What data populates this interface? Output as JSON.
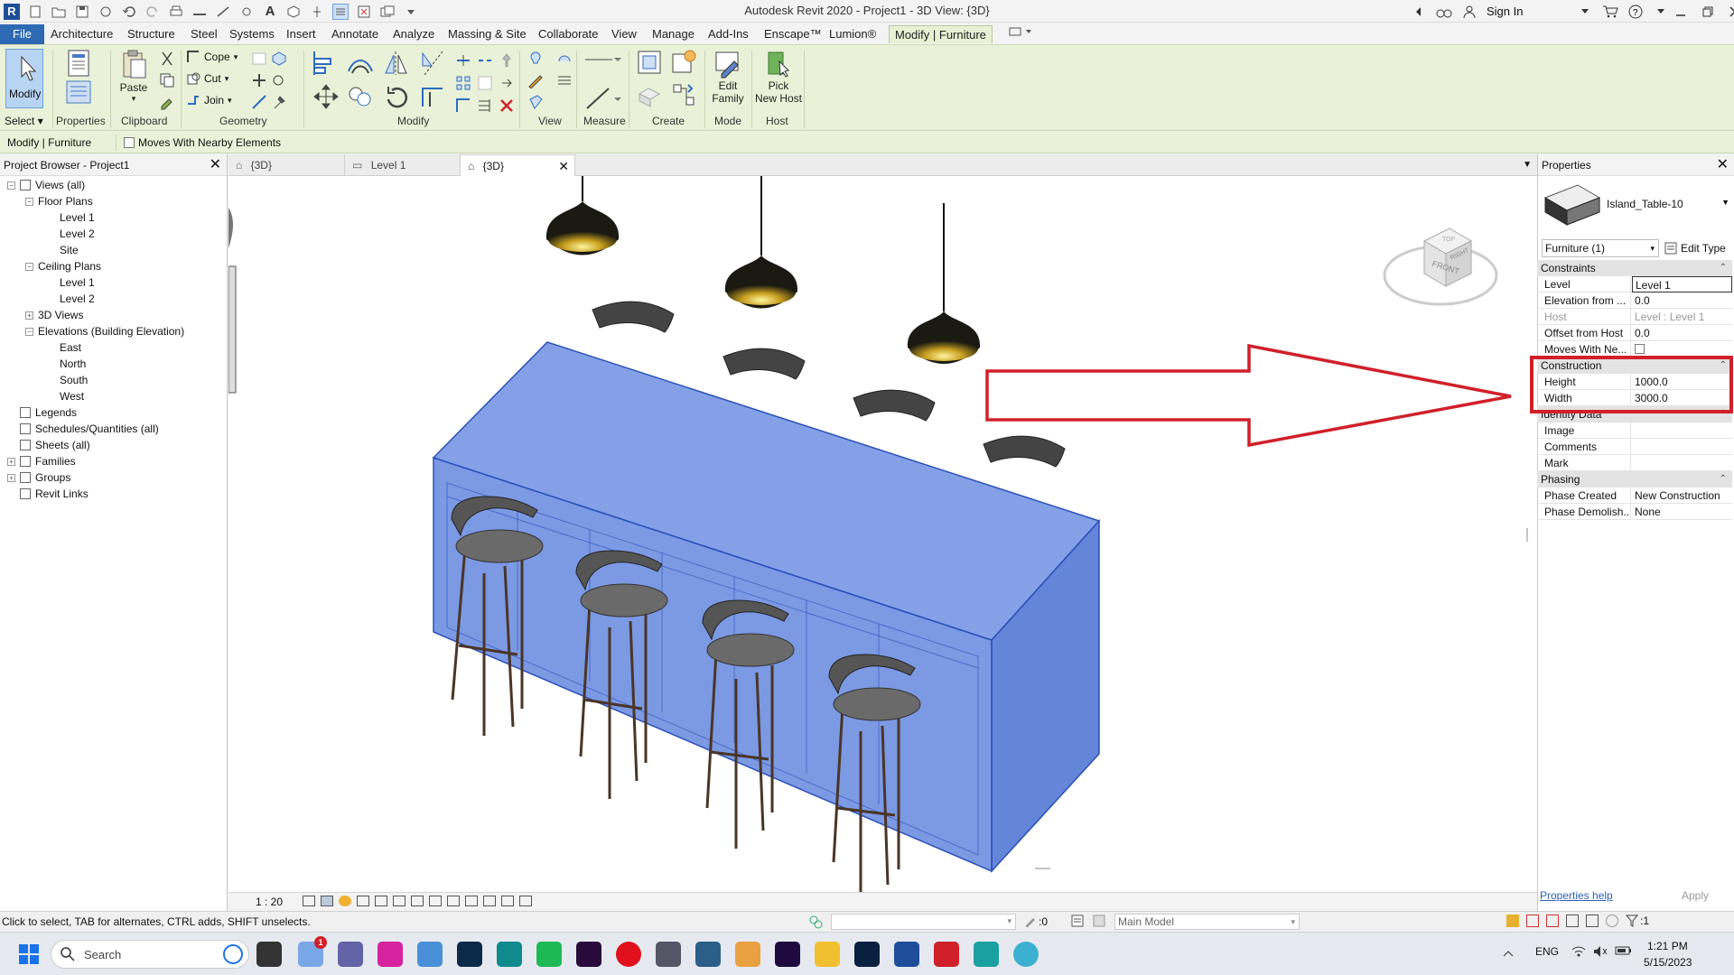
{
  "app": {
    "window_title": "Autodesk Revit 2020 - Project1 - 3D View: {3D}",
    "sign_in": "Sign In",
    "logo_letter": "R"
  },
  "menu": {
    "tabs": [
      "File",
      "Architecture",
      "Structure",
      "Steel",
      "Systems",
      "Insert",
      "Annotate",
      "Analyze",
      "Massing & Site",
      "Collaborate",
      "View",
      "Manage",
      "Add-Ins",
      "Enscape™",
      "Lumion®",
      "Modify | Furniture"
    ],
    "active_tab": "Modify | Furniture"
  },
  "ribbon": {
    "modify_label": "Modify",
    "select_label": "Select",
    "properties_label": "Properties",
    "paste_label": "Paste",
    "cope_label": "Cope",
    "cut_label": "Cut",
    "join_label": "Join",
    "edit_family_label_1": "Edit",
    "edit_family_label_2": "Family",
    "pick_host_label_1": "Pick",
    "pick_host_label_2": "New Host",
    "panels": {
      "clipboard": "Clipboard",
      "geometry": "Geometry",
      "modify": "Modify",
      "view": "View",
      "measure": "Measure",
      "create": "Create",
      "mode": "Mode",
      "host": "Host"
    }
  },
  "options_bar": {
    "context": "Modify | Furniture",
    "moves_with_nearby": "Moves With Nearby Elements"
  },
  "project_browser": {
    "title": "Project Browser - Project1",
    "items": [
      {
        "label": "Views (all)",
        "level": 0,
        "toggle": "−"
      },
      {
        "label": "Floor Plans",
        "level": 1,
        "toggle": "−"
      },
      {
        "label": "Level 1",
        "level": 2
      },
      {
        "label": "Level 2",
        "level": 2
      },
      {
        "label": "Site",
        "level": 2
      },
      {
        "label": "Ceiling Plans",
        "level": 1,
        "toggle": "−"
      },
      {
        "label": "Level 1",
        "level": 2
      },
      {
        "label": "Level 2",
        "level": 2
      },
      {
        "label": "3D Views",
        "level": 1,
        "toggle": "+"
      },
      {
        "label": "Elevations (Building Elevation)",
        "level": 1,
        "toggle": "−"
      },
      {
        "label": "East",
        "level": 2
      },
      {
        "label": "North",
        "level": 2
      },
      {
        "label": "South",
        "level": 2
      },
      {
        "label": "West",
        "level": 2
      },
      {
        "label": "Legends",
        "level": 0
      },
      {
        "label": "Schedules/Quantities (all)",
        "level": 0
      },
      {
        "label": "Sheets (all)",
        "level": 0
      },
      {
        "label": "Families",
        "level": 0,
        "toggle": "+"
      },
      {
        "label": "Groups",
        "level": 0,
        "toggle": "+"
      },
      {
        "label": "Revit Links",
        "level": 0
      }
    ]
  },
  "view_tabs": [
    {
      "label": "{3D}"
    },
    {
      "label": "Level 1"
    },
    {
      "label": "{3D}",
      "active": true
    }
  ],
  "view_control": {
    "scale": "1 : 20"
  },
  "view_cube": {
    "top": "TOP",
    "front": "FRONT",
    "right": "RIGHT"
  },
  "properties": {
    "title": "Properties",
    "type_name": "Island_Table-10",
    "selector": "Furniture (1)",
    "edit_type": "Edit Type",
    "groups": {
      "constraints": "Constraints",
      "construction": "Construction",
      "identity": "Identity Data",
      "phasing": "Phasing"
    },
    "constraints": {
      "level_k": "Level",
      "level_v": "Level 1",
      "elev_k": "Elevation from ...",
      "elev_v": "0.0",
      "host_k": "Host",
      "host_v": "Level : Level 1",
      "offset_k": "Offset from Host",
      "offset_v": "0.0",
      "moves_k": "Moves With Ne..."
    },
    "construction": {
      "height_k": "Height",
      "height_v": "1000.0",
      "width_k": "Width",
      "width_v": "3000.0"
    },
    "identity": {
      "image_k": "Image",
      "comments_k": "Comments",
      "mark_k": "Mark"
    },
    "phasing": {
      "created_k": "Phase Created",
      "created_v": "New Construction",
      "demolished_k": "Phase Demolish...",
      "demolished_v": "None"
    },
    "help": "Properties help",
    "apply": "Apply"
  },
  "status_bar": {
    "hint": "Click to select, TAB for alternates, CTRL adds, SHIFT unselects.",
    "count": ":0",
    "workset": "Main Model",
    "filter": ":1"
  },
  "taskbar": {
    "search_placeholder": "Search",
    "lang": "ENG",
    "time": "1:21 PM",
    "date": "5/15/2023",
    "notification_badge": "1"
  },
  "colors": {
    "ribbon_bg": "#e9f2d8",
    "selection_blue": "#3a66d6",
    "annotation_red": "#d0202a",
    "file_tab": "#2d6ab3"
  }
}
